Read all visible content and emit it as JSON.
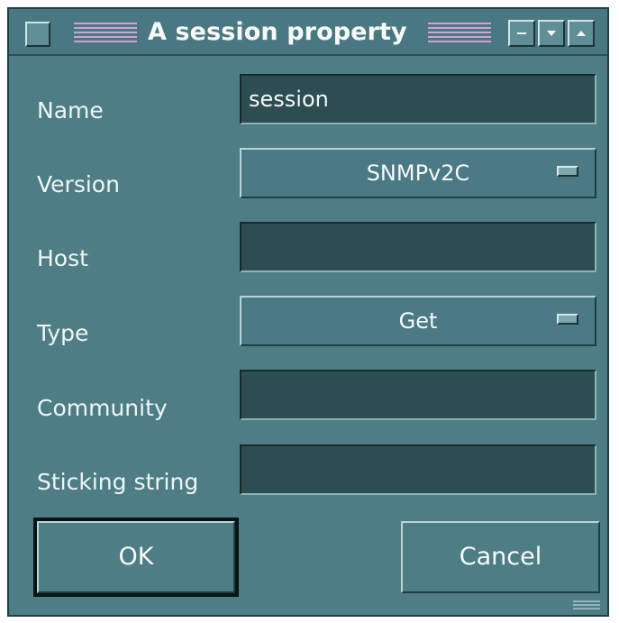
{
  "window": {
    "title": "A session property"
  },
  "form": {
    "name": {
      "label": "Name",
      "value": "session"
    },
    "version": {
      "label": "Version",
      "value": "SNMPv2C"
    },
    "host": {
      "label": "Host",
      "value": ""
    },
    "type": {
      "label": "Type",
      "value": "Get"
    },
    "community": {
      "label": "Community",
      "value": ""
    },
    "sticking_string": {
      "label": "Sticking string",
      "value": ""
    }
  },
  "buttons": {
    "ok": "OK",
    "cancel": "Cancel"
  },
  "icons": {
    "window_menu": "window-menu-icon",
    "minimize": "minimize-icon",
    "shade_down": "shade-down-icon",
    "maximize": "maximize-icon",
    "dropdown": "dropdown-indicator-icon",
    "resize": "resize-grip-icon"
  },
  "colors": {
    "window_bg": "#4f7d86",
    "field_bg": "#2e4d52",
    "text": "#f3fafa",
    "title_lines": "#d9a3d8"
  }
}
